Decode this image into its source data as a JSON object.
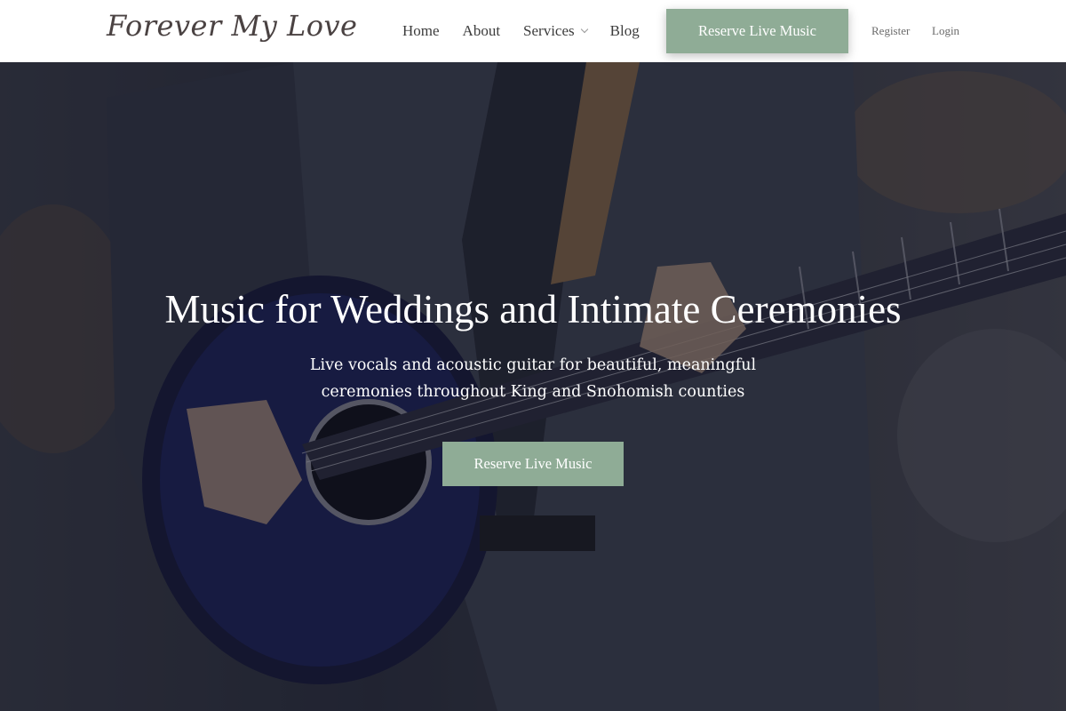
{
  "header": {
    "logo": "Forever My Love",
    "nav": [
      {
        "label": "Home"
      },
      {
        "label": "About"
      },
      {
        "label": "Services",
        "dropdown": true
      },
      {
        "label": "Blog"
      }
    ],
    "cta_label": "Reserve Live Music",
    "register_label": "Register",
    "login_label": "Login"
  },
  "hero": {
    "title": "Music for Weddings and Intimate Ceremonies",
    "subtitle_line1": "Live vocals and acoustic guitar for beautiful, meaningful",
    "subtitle_line2": "ceremonies throughout King and Snohomish counties",
    "cta_label": "Reserve Live Music",
    "image": "guitarist-playing-acoustic-guitar"
  },
  "colors": {
    "accent": "#8fac96",
    "header_bg": "#ffffff",
    "nav_text": "#3c3c3c"
  }
}
